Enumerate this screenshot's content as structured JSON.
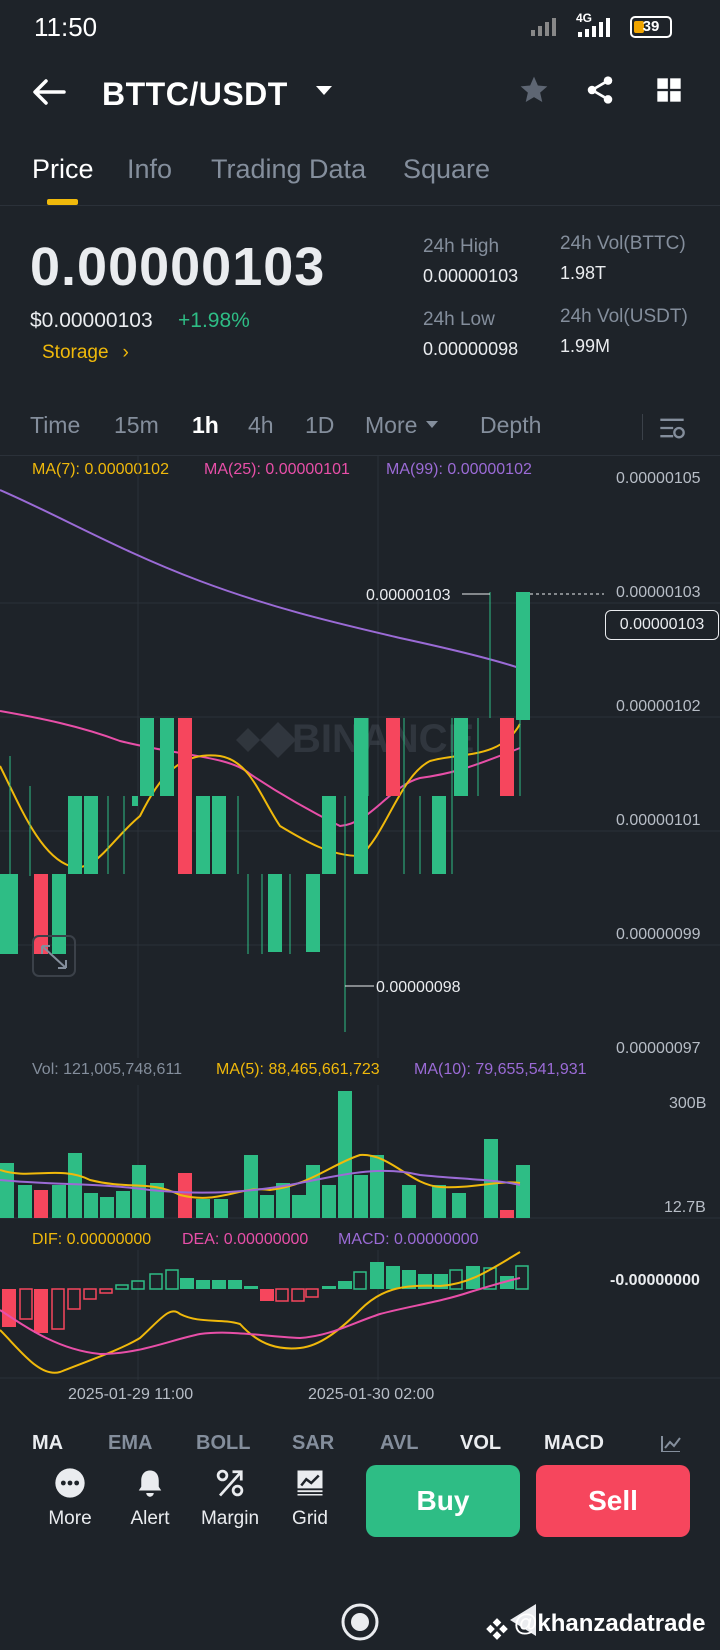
{
  "status_bar": {
    "time": "11:50",
    "network": "4G",
    "battery": "39"
  },
  "header": {
    "pair": "BTTC/USDT"
  },
  "tabs": [
    {
      "label": "Price",
      "active": true
    },
    {
      "label": "Info",
      "active": false
    },
    {
      "label": "Trading Data",
      "active": false
    },
    {
      "label": "Square",
      "active": false
    }
  ],
  "price": {
    "last": "0.00000103",
    "usd": "$0.00000103",
    "change": "+1.98%",
    "tag": "Storage"
  },
  "stats": {
    "high_label": "24h High",
    "high": "0.00000103",
    "low_label": "24h Low",
    "low": "0.00000098",
    "vol_base_label": "24h Vol(BTTC)",
    "vol_base": "1.98T",
    "vol_quote_label": "24h Vol(USDT)",
    "vol_quote": "1.99M"
  },
  "intervals": [
    "Time",
    "15m",
    "1h",
    "4h",
    "1D",
    "More",
    "Depth"
  ],
  "active_interval": "1h",
  "indicators": {
    "ma7": "MA(7): 0.00000102",
    "ma25": "MA(25): 0.00000101",
    "ma99": "MA(99): 0.00000102",
    "vol": "Vol: 121,005,748,611",
    "vol_ma5": "MA(5): 88,465,661,723",
    "vol_ma10": "MA(10): 79,655,541,931",
    "dif": "DIF: 0.00000000",
    "dea": "DEA: 0.00000000",
    "macd": "MACD: 0.00000000"
  },
  "price_axis": [
    "0.00000105",
    "0.00000103",
    "0.00000102",
    "0.00000101",
    "0.00000099",
    "0.00000097"
  ],
  "price_tag": "0.00000103",
  "high_marker": "0.00000103",
  "low_marker": "0.00000098",
  "vol_axis": [
    "300B",
    "12.7B"
  ],
  "macd_axis": "-0.00000000",
  "time_axis": [
    "2025-01-29 11:00",
    "2025-01-30 02:00"
  ],
  "indicator_tabs": [
    "MA",
    "EMA",
    "BOLL",
    "SAR",
    "AVL",
    "VOL",
    "MACD"
  ],
  "bottom_actions": [
    "More",
    "Alert",
    "Margin",
    "Grid"
  ],
  "buy_label": "Buy",
  "sell_label": "Sell",
  "watermark_logo": "BINANCE",
  "watermark_user": "@khanzadatrade",
  "colors": {
    "up": "#2ebd85",
    "down": "#f6465d",
    "accent": "#f0b90b",
    "ma7": "#f0b90b",
    "ma25": "#e84fa8",
    "ma99": "#9b6bd6"
  },
  "chart_data": {
    "type": "candlestick",
    "y_range": [
      9.7e-07,
      1.05e-06
    ],
    "candles": [
      {
        "o": 1e-06,
        "h": 1.01e-06,
        "l": 9.9e-07,
        "c": 9.9e-07,
        "dir": "up"
      },
      {
        "o": 1e-06,
        "h": 1e-06,
        "l": 9.9e-07,
        "c": 9.9e-07,
        "dir": "down"
      },
      {
        "o": 9.9e-07,
        "h": 1e-06,
        "l": 9.9e-07,
        "c": 1e-06,
        "dir": "up"
      },
      {
        "o": 1e-06,
        "h": 1.01e-06,
        "l": 1e-06,
        "c": 1.01e-06,
        "dir": "up"
      },
      {
        "o": 1.01e-06,
        "h": 1.02e-06,
        "l": 1.01e-06,
        "c": 1.02e-06,
        "dir": "up"
      },
      {
        "o": 1.02e-06,
        "h": 1.02e-06,
        "l": 1e-06,
        "c": 1e-06,
        "dir": "down"
      },
      {
        "o": 1e-06,
        "h": 1.01e-06,
        "l": 1e-06,
        "c": 1.01e-06,
        "dir": "up"
      },
      {
        "o": 1e-06,
        "h": 1e-06,
        "l": 9.9e-07,
        "c": 9.9e-07,
        "dir": "up"
      },
      {
        "o": 1e-06,
        "h": 1.01e-06,
        "l": 9.8e-07,
        "c": 1.01e-06,
        "dir": "up"
      },
      {
        "o": 1.01e-06,
        "h": 1.02e-06,
        "l": 1.01e-06,
        "c": 1.02e-06,
        "dir": "up"
      },
      {
        "o": 1.02e-06,
        "h": 1.02e-06,
        "l": 1.01e-06,
        "c": 1.01e-06,
        "dir": "down"
      },
      {
        "o": 1.01e-06,
        "h": 1.02e-06,
        "l": 1e-06,
        "c": 1.01e-06,
        "dir": "up"
      },
      {
        "o": 1.01e-06,
        "h": 1.02e-06,
        "l": 1.01e-06,
        "c": 1.02e-06,
        "dir": "up"
      },
      {
        "o": 1.02e-06,
        "h": 1.02e-06,
        "l": 1.01e-06,
        "c": 1.01e-06,
        "dir": "down"
      },
      {
        "o": 1.02e-06,
        "h": 1.03e-06,
        "l": 1.02e-06,
        "c": 1.03e-06,
        "dir": "up"
      }
    ]
  }
}
